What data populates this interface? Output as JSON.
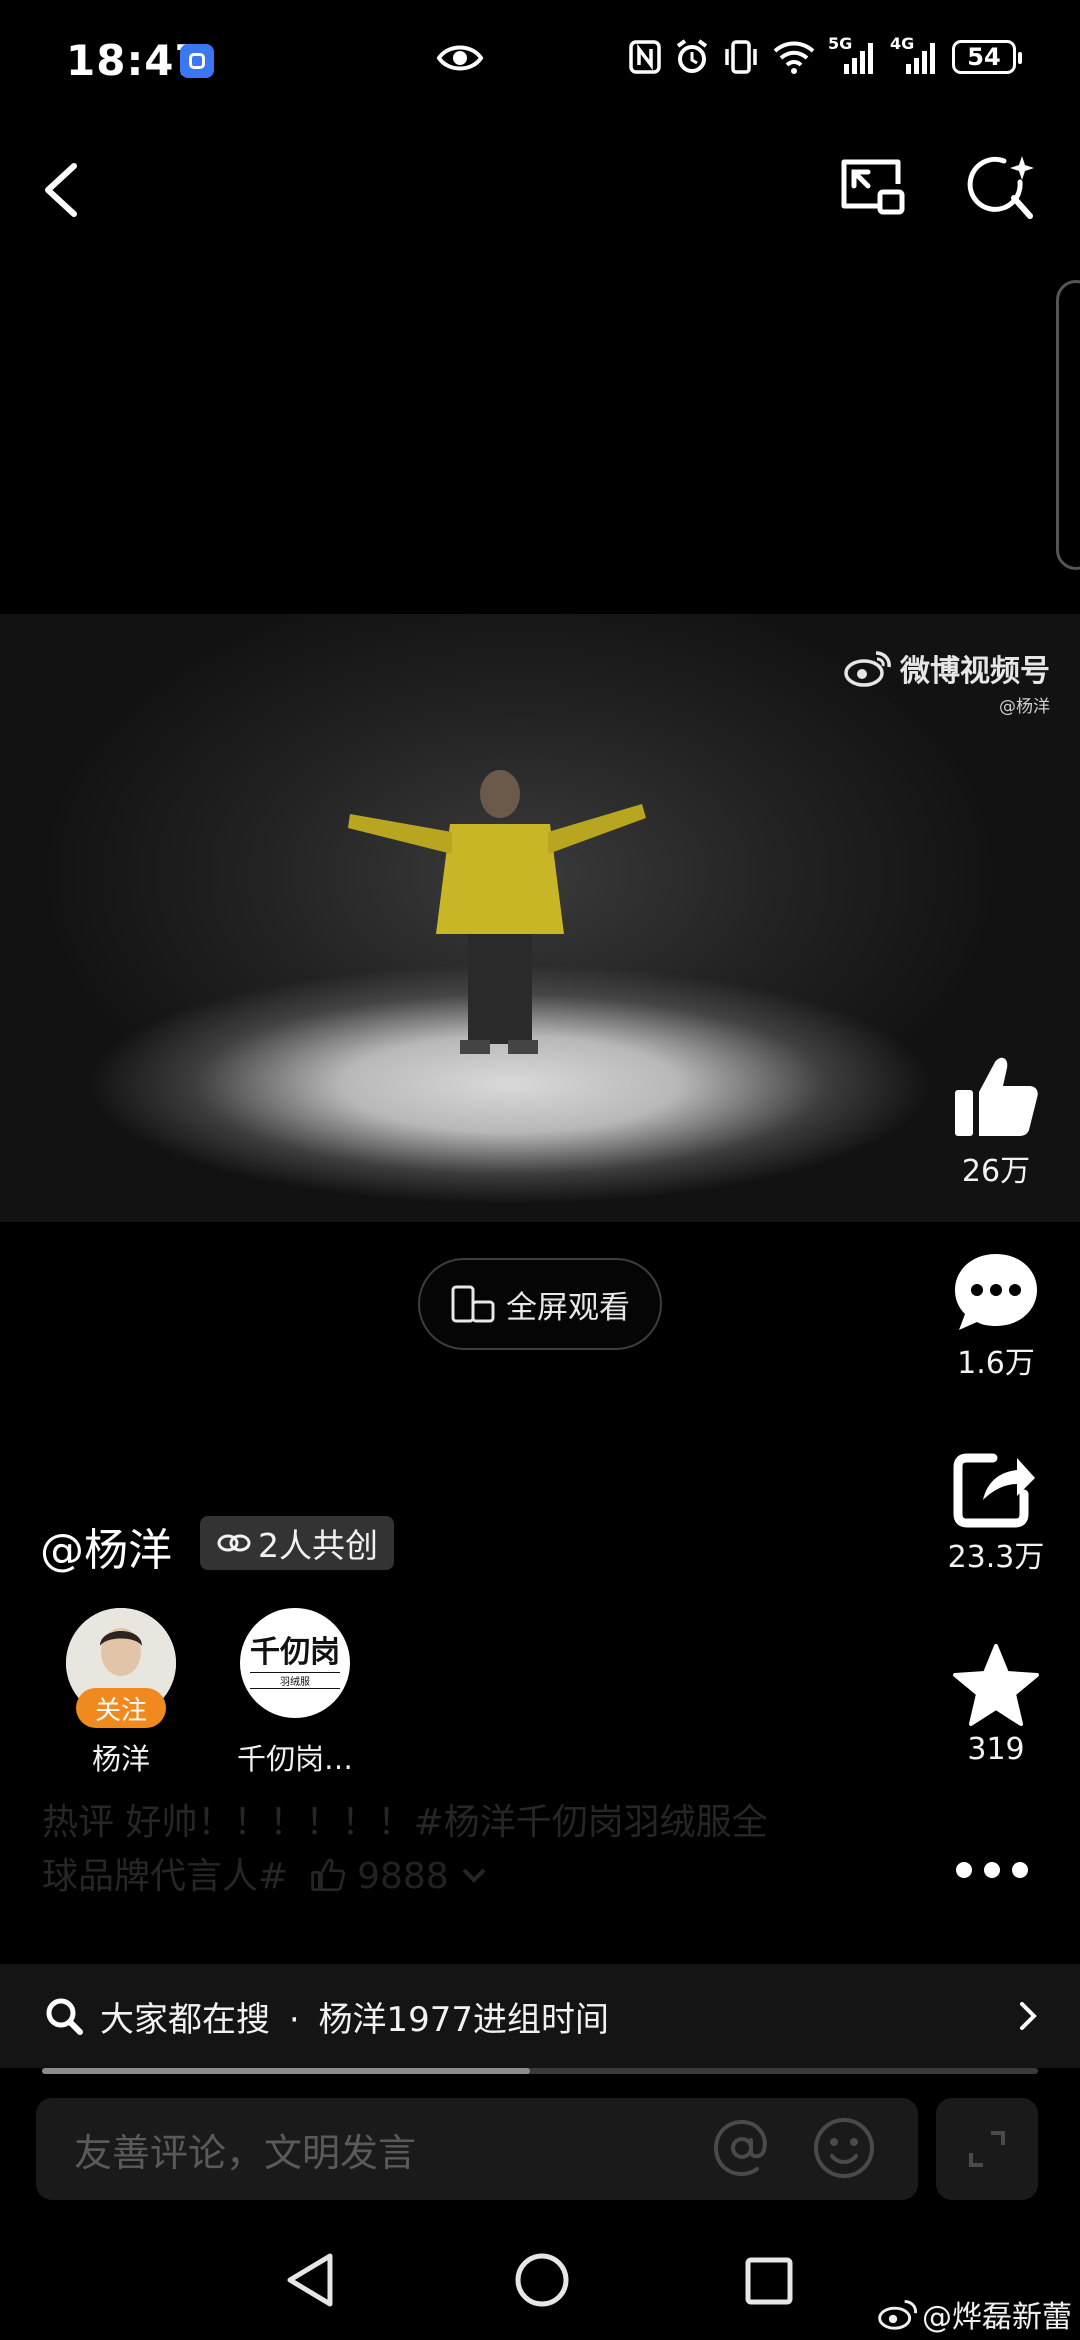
{
  "status_bar": {
    "time": "18:47",
    "network_5g": "5G",
    "network_4g": "4G",
    "battery": "54"
  },
  "video": {
    "watermark_title": "微博视频号",
    "watermark_handle": "@杨洋"
  },
  "fullscreen_label": "全屏观看",
  "actions": {
    "like_count": "26万",
    "comment_count": "1.6万",
    "share_count": "23.3万",
    "favorite_count": "319"
  },
  "author": {
    "handle": "@杨洋",
    "cocreate_label": "2人共创"
  },
  "creators": [
    {
      "name": "杨洋",
      "follow_label": "关注"
    },
    {
      "name": "千仞岗…",
      "logo_text": "千仞岗",
      "logo_sub": "羽绒服"
    }
  ],
  "caption": {
    "line1": "热评  好帅！！！！！！#杨洋千仞岗羽绒服全",
    "line2": "球品牌代言人#",
    "likes": "9888"
  },
  "search_suggestion": {
    "prefix": "大家都在搜",
    "separator": "·",
    "query": "杨洋1977进组时间"
  },
  "progress_fraction": 0.49,
  "comment_input": {
    "placeholder": "友善评论，文明发言"
  },
  "corner_watermark": "@烨磊新蕾",
  "colors": {
    "follow_tag": "#f08a1e",
    "background": "#000000"
  }
}
